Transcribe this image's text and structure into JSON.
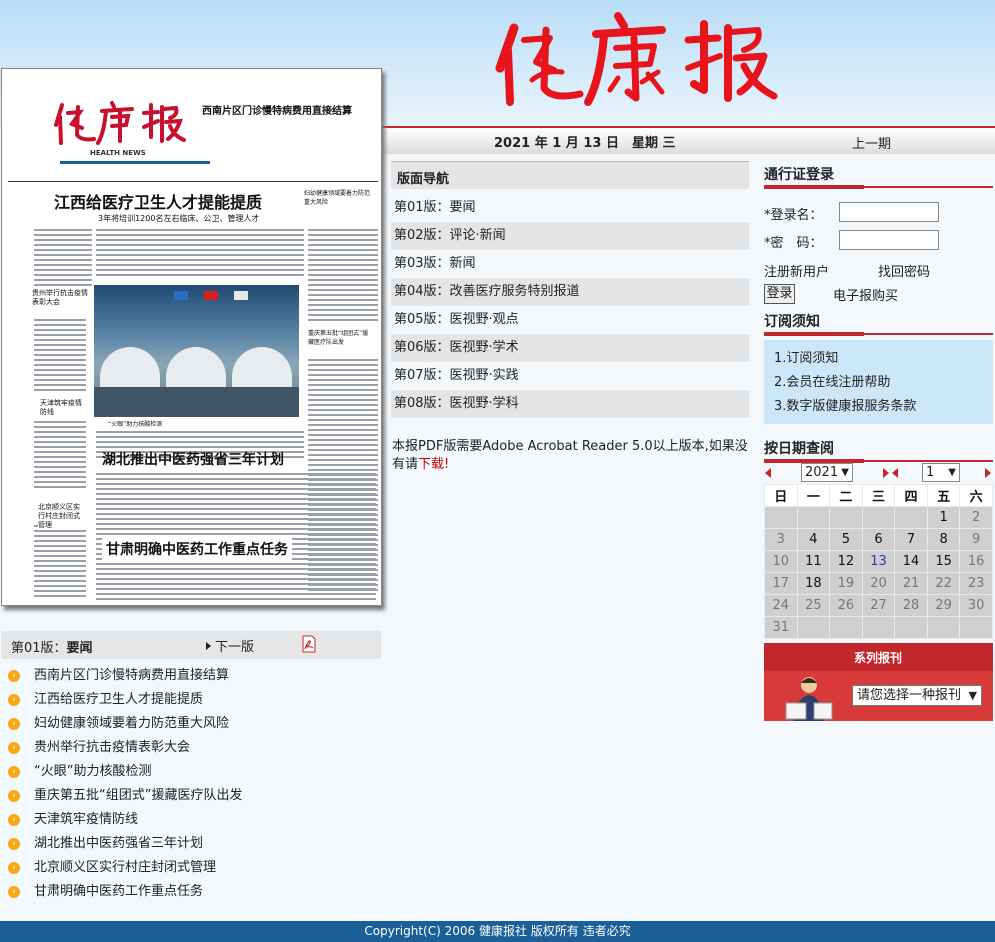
{
  "masthead": {
    "logo_text": "健康报"
  },
  "thumbnail": {
    "logo_text": "健康报",
    "health_news": "HEALTH NEWS",
    "top_headline": "西南片区门诊慢特病费用直接结算",
    "main_headline": "江西给医疗卫生人才提能提质",
    "main_subhead": "3年将培训1200名左右临床、公卫、管理人才",
    "side1": "贵州举行抗击疫情表彰大会",
    "side2": "天津筑牢疫情防线",
    "side3": "北京顺义区实行村庄封闭式管理",
    "side4": "妇幼健康领域要着力防范重大风险",
    "side5": "重庆第五批“组团式”援藏医疗队出发",
    "caption": "“火眼”助力核酸检测",
    "headline2": "湖北推出中医药强省三年计划",
    "headline3": "甘肃明确中医药工作重点任务"
  },
  "edition": {
    "label_prefix": "第01版：",
    "label_name": "要闻",
    "next": "下一版"
  },
  "articles": [
    "西南片区门诊慢特病费用直接结算",
    "江西给医疗卫生人才提能提质",
    "妇幼健康领域要着力防范重大风险",
    "贵州举行抗击疫情表彰大会",
    "“火眼”助力核酸检测",
    "重庆第五批“组团式”援藏医疗队出发",
    "天津筑牢疫情防线",
    "湖北推出中医药强省三年计划",
    "北京顺义区实行村庄封闭式管理",
    "甘肃明确中医药工作重点任务"
  ],
  "date_bar": {
    "date": "2021 年 1 月 13 日　星期 三",
    "prev": "上一期"
  },
  "nav": {
    "title": "版面导航",
    "items": [
      "第01版：要闻",
      "第02版：评论·新闻",
      "第03版：新闻",
      "第04版：改善医疗服务特别报道",
      "第05版：医视野·观点",
      "第06版：医视野·学术",
      "第07版：医视野·实践",
      "第08版：医视野·学科"
    ]
  },
  "pdf_note": {
    "text": "本报PDF版需要Adobe Acrobat Reader 5.0以上版本,如果没有请",
    "link": "下载!"
  },
  "login": {
    "title": "通行证登录",
    "username_label": "*登录名：",
    "password_label": "*密　码：",
    "register": "注册新用户",
    "forgot": "找回密码",
    "button": "登录",
    "buy": "电子报购买"
  },
  "notice": {
    "title": "订阅须知",
    "items": [
      "1.订阅须知",
      "2.会员在线注册帮助",
      "3.数字版健康报服务条款"
    ]
  },
  "calendar": {
    "title": "按日期查阅",
    "year": "2021",
    "month": "1",
    "weekdays": [
      "日",
      "一",
      "二",
      "三",
      "四",
      "五",
      "六"
    ],
    "rows": [
      [
        "",
        "",
        "",
        "",
        "",
        "1",
        "2"
      ],
      [
        "3",
        "4",
        "5",
        "6",
        "7",
        "8",
        "9"
      ],
      [
        "10",
        "11",
        "12",
        "13",
        "14",
        "15",
        "16"
      ],
      [
        "17",
        "18",
        "19",
        "20",
        "21",
        "22",
        "23"
      ],
      [
        "24",
        "25",
        "26",
        "27",
        "28",
        "29",
        "30"
      ],
      [
        "31",
        "",
        "",
        "",
        "",
        "",
        ""
      ]
    ],
    "active_days": [
      "1",
      "4",
      "5",
      "6",
      "7",
      "8",
      "11",
      "12",
      "13",
      "14",
      "15",
      "18"
    ],
    "today": "13"
  },
  "series": {
    "title": "系列报刊",
    "select": "请您选择一种报刊"
  },
  "footer": "Copyright(C) 2006 健康报社 版权所有 违者必究",
  "colors": {
    "brand_red": "#c1272d",
    "footer_blue": "#1a5f97",
    "bullet_orange": "#f6a91b",
    "today_blue": "#1e3fb5"
  }
}
